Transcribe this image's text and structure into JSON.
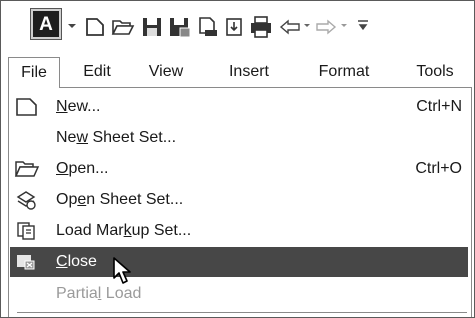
{
  "app": {
    "button_letter": "A",
    "accent": "#1e1e1e",
    "highlight": "#474747"
  },
  "toolbar": {
    "icons": [
      "new-icon",
      "open-icon",
      "save-icon",
      "save-as-icon",
      "plot-preview-icon",
      "publish-icon",
      "print-icon",
      "undo-icon",
      "redo-icon",
      "customize-icon"
    ]
  },
  "menubar": {
    "items": [
      {
        "label": "File",
        "active": true
      },
      {
        "label": "Edit"
      },
      {
        "label": "View"
      },
      {
        "label": "Insert"
      },
      {
        "label": "Format"
      },
      {
        "label": "Tools"
      }
    ]
  },
  "file_menu": {
    "items": [
      {
        "pre": "",
        "ul": "N",
        "post": "ew...",
        "shortcut": "Ctrl+N",
        "icon": "new-document-icon"
      },
      {
        "pre": "Ne",
        "ul": "w",
        "post": " Sheet Set...",
        "shortcut": "",
        "icon": ""
      },
      {
        "pre": "",
        "ul": "O",
        "post": "pen...",
        "shortcut": "Ctrl+O",
        "icon": "open-folder-icon"
      },
      {
        "pre": "Op",
        "ul": "e",
        "post": "n Sheet Set...",
        "shortcut": "",
        "icon": "open-sheet-set-icon"
      },
      {
        "pre": "Load Mar",
        "ul": "k",
        "post": "up Set...",
        "shortcut": "",
        "icon": "markup-set-icon"
      },
      {
        "pre": "",
        "ul": "C",
        "post": "lose",
        "shortcut": "",
        "icon": "close-drawing-icon",
        "highlighted": true
      },
      {
        "pre": "Partia",
        "ul": "l",
        "post": " Load",
        "shortcut": "",
        "icon": "",
        "disabled": true
      }
    ]
  }
}
